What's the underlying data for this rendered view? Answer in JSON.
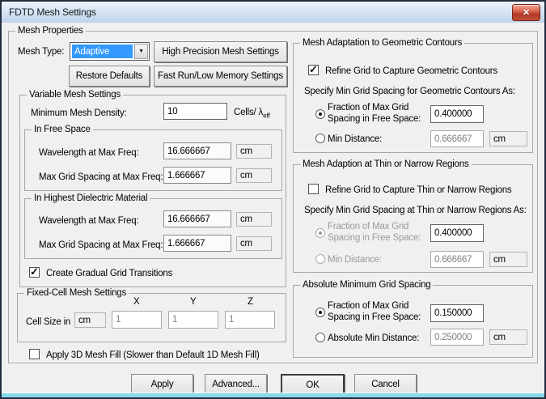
{
  "icons": {
    "close": "✕",
    "dropdown_arrow": "▼",
    "checkmark": "✓"
  },
  "colors": {
    "selection_blue": "#3399ff",
    "titlebar_top": "#eef4fc",
    "titlebar_bottom": "#bfd3ea",
    "close_button_red": "#c14d37",
    "dialog_bg": "#f0f0f0",
    "bottom_strip_cyan": "#86daec",
    "disabled_text": "#9b9b9b"
  },
  "window": {
    "title": "FDTD Mesh Settings"
  },
  "mesh_properties": {
    "label": "Mesh Properties",
    "mesh_type_label": "Mesh Type:",
    "mesh_type_value": "Adaptive",
    "high_precision_button": "High Precision Mesh Settings",
    "restore_defaults_button": "Restore Defaults",
    "fast_run_button": "Fast Run/Low Memory Settings"
  },
  "variable_mesh": {
    "label": "Variable Mesh Settings",
    "min_density_label": "Minimum Mesh Density:",
    "min_density_value": "10",
    "unit_prefix": "Cells/ λ",
    "unit_sub": "eff",
    "free_space": {
      "label": "In Free Space",
      "wavelength_label": "Wavelength at Max Freq:",
      "wavelength_value": "16.666667",
      "wavelength_unit": "cm",
      "spacing_label": "Max Grid Spacing at Max Freq:",
      "spacing_value": "1.666667",
      "spacing_unit": "cm"
    },
    "dielectric": {
      "label": "In Highest Dielectric Material",
      "wavelength_label": "Wavelength at Max Freq:",
      "wavelength_value": "16.666667",
      "wavelength_unit": "cm",
      "spacing_label": "Max Grid Spacing at Max Freq:",
      "spacing_value": "1.666667",
      "spacing_unit": "cm"
    },
    "gradual_transitions_label": "Create Gradual Grid Transitions"
  },
  "fixed_cell": {
    "label": "Fixed-Cell Mesh Settings",
    "col_x": "X",
    "col_y": "Y",
    "col_z": "Z",
    "cell_size_label": "Cell Size in",
    "unit_value": "cm",
    "x_value": "1",
    "y_value": "1",
    "z_value": "1"
  },
  "apply_3d_label": "Apply 3D Mesh Fill (Slower than Default 1D Mesh Fill)",
  "geometric_contours": {
    "label": "Mesh Adaptation to Geometric Contours",
    "refine_label": "Refine Grid to Capture Geometric Contours",
    "specify_label": "Specify Min Grid Spacing for Geometric Contours As:",
    "fraction_line1": "Fraction of Max Grid",
    "fraction_line2": "Spacing in Free Space:",
    "fraction_value": "0.400000",
    "min_distance_label": "Min Distance:",
    "min_distance_value": "0.666667",
    "min_distance_unit": "cm"
  },
  "thin_regions": {
    "label": "Mesh Adaption at Thin or Narrow Regions",
    "refine_label": "Refine Grid to Capture Thin or Narrow Regions",
    "specify_label": "Specify Min Grid Spacing at Thin or Narrow Regions As:",
    "fraction_line1": "Fraction of Max Grid",
    "fraction_line2": "Spacing in Free Space:",
    "fraction_value": "0.400000",
    "min_distance_label": "Min Distance:",
    "min_distance_value": "0.666667",
    "min_distance_unit": "cm"
  },
  "absolute_min": {
    "label": "Absolute Minimum Grid Spacing",
    "fraction_line1": "Fraction of Max Grid",
    "fraction_line2": "Spacing in Free Space:",
    "fraction_value": "0.150000",
    "abs_min_label": "Absolute Min Distance:",
    "abs_min_value": "0.250000",
    "abs_min_unit": "cm"
  },
  "footer": {
    "apply": "Apply",
    "advanced": "Advanced...",
    "ok": "OK",
    "cancel": "Cancel"
  }
}
